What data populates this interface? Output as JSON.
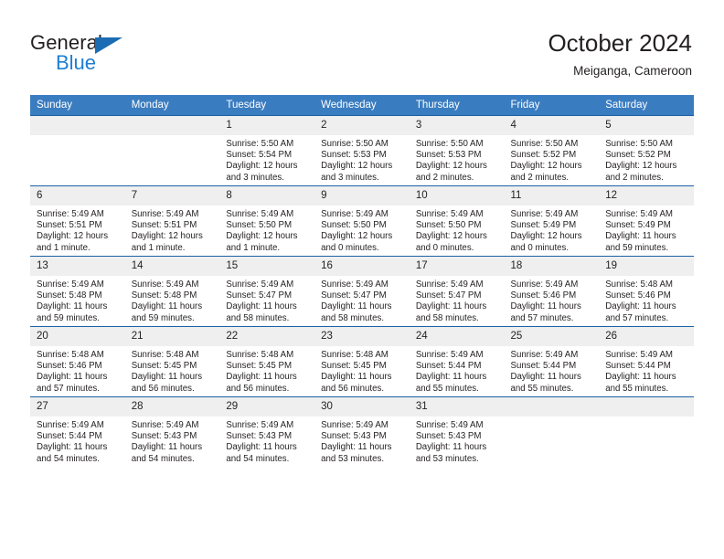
{
  "brand": {
    "name_top": "General",
    "name_bottom": "Blue",
    "triangle_color": "#1c6cb3",
    "blue_text_color": "#1b7fd4"
  },
  "header": {
    "title": "October 2024",
    "subtitle": "Meiganga, Cameroon",
    "header_bg": "#3a7cc0",
    "cell_border": "#1c60a8",
    "daynum_bg": "#efefef"
  },
  "weekday_headers": [
    "Sunday",
    "Monday",
    "Tuesday",
    "Wednesday",
    "Thursday",
    "Friday",
    "Saturday"
  ],
  "labels": {
    "sunrise_prefix": "Sunrise:",
    "sunset_prefix": "Sunset:",
    "daylight_prefix": "Daylight:"
  },
  "weeks": [
    [
      {
        "day": "",
        "blank": true
      },
      {
        "day": "",
        "blank": true
      },
      {
        "day": "1",
        "sunrise": "Sunrise: 5:50 AM",
        "sunset": "Sunset: 5:54 PM",
        "daylight_line1": "Daylight: 12 hours",
        "daylight_line2": "and 3 minutes."
      },
      {
        "day": "2",
        "sunrise": "Sunrise: 5:50 AM",
        "sunset": "Sunset: 5:53 PM",
        "daylight_line1": "Daylight: 12 hours",
        "daylight_line2": "and 3 minutes."
      },
      {
        "day": "3",
        "sunrise": "Sunrise: 5:50 AM",
        "sunset": "Sunset: 5:53 PM",
        "daylight_line1": "Daylight: 12 hours",
        "daylight_line2": "and 2 minutes."
      },
      {
        "day": "4",
        "sunrise": "Sunrise: 5:50 AM",
        "sunset": "Sunset: 5:52 PM",
        "daylight_line1": "Daylight: 12 hours",
        "daylight_line2": "and 2 minutes."
      },
      {
        "day": "5",
        "sunrise": "Sunrise: 5:50 AM",
        "sunset": "Sunset: 5:52 PM",
        "daylight_line1": "Daylight: 12 hours",
        "daylight_line2": "and 2 minutes."
      }
    ],
    [
      {
        "day": "6",
        "sunrise": "Sunrise: 5:49 AM",
        "sunset": "Sunset: 5:51 PM",
        "daylight_line1": "Daylight: 12 hours",
        "daylight_line2": "and 1 minute."
      },
      {
        "day": "7",
        "sunrise": "Sunrise: 5:49 AM",
        "sunset": "Sunset: 5:51 PM",
        "daylight_line1": "Daylight: 12 hours",
        "daylight_line2": "and 1 minute."
      },
      {
        "day": "8",
        "sunrise": "Sunrise: 5:49 AM",
        "sunset": "Sunset: 5:50 PM",
        "daylight_line1": "Daylight: 12 hours",
        "daylight_line2": "and 1 minute."
      },
      {
        "day": "9",
        "sunrise": "Sunrise: 5:49 AM",
        "sunset": "Sunset: 5:50 PM",
        "daylight_line1": "Daylight: 12 hours",
        "daylight_line2": "and 0 minutes."
      },
      {
        "day": "10",
        "sunrise": "Sunrise: 5:49 AM",
        "sunset": "Sunset: 5:50 PM",
        "daylight_line1": "Daylight: 12 hours",
        "daylight_line2": "and 0 minutes."
      },
      {
        "day": "11",
        "sunrise": "Sunrise: 5:49 AM",
        "sunset": "Sunset: 5:49 PM",
        "daylight_line1": "Daylight: 12 hours",
        "daylight_line2": "and 0 minutes."
      },
      {
        "day": "12",
        "sunrise": "Sunrise: 5:49 AM",
        "sunset": "Sunset: 5:49 PM",
        "daylight_line1": "Daylight: 11 hours",
        "daylight_line2": "and 59 minutes."
      }
    ],
    [
      {
        "day": "13",
        "sunrise": "Sunrise: 5:49 AM",
        "sunset": "Sunset: 5:48 PM",
        "daylight_line1": "Daylight: 11 hours",
        "daylight_line2": "and 59 minutes."
      },
      {
        "day": "14",
        "sunrise": "Sunrise: 5:49 AM",
        "sunset": "Sunset: 5:48 PM",
        "daylight_line1": "Daylight: 11 hours",
        "daylight_line2": "and 59 minutes."
      },
      {
        "day": "15",
        "sunrise": "Sunrise: 5:49 AM",
        "sunset": "Sunset: 5:47 PM",
        "daylight_line1": "Daylight: 11 hours",
        "daylight_line2": "and 58 minutes."
      },
      {
        "day": "16",
        "sunrise": "Sunrise: 5:49 AM",
        "sunset": "Sunset: 5:47 PM",
        "daylight_line1": "Daylight: 11 hours",
        "daylight_line2": "and 58 minutes."
      },
      {
        "day": "17",
        "sunrise": "Sunrise: 5:49 AM",
        "sunset": "Sunset: 5:47 PM",
        "daylight_line1": "Daylight: 11 hours",
        "daylight_line2": "and 58 minutes."
      },
      {
        "day": "18",
        "sunrise": "Sunrise: 5:49 AM",
        "sunset": "Sunset: 5:46 PM",
        "daylight_line1": "Daylight: 11 hours",
        "daylight_line2": "and 57 minutes."
      },
      {
        "day": "19",
        "sunrise": "Sunrise: 5:48 AM",
        "sunset": "Sunset: 5:46 PM",
        "daylight_line1": "Daylight: 11 hours",
        "daylight_line2": "and 57 minutes."
      }
    ],
    [
      {
        "day": "20",
        "sunrise": "Sunrise: 5:48 AM",
        "sunset": "Sunset: 5:46 PM",
        "daylight_line1": "Daylight: 11 hours",
        "daylight_line2": "and 57 minutes."
      },
      {
        "day": "21",
        "sunrise": "Sunrise: 5:48 AM",
        "sunset": "Sunset: 5:45 PM",
        "daylight_line1": "Daylight: 11 hours",
        "daylight_line2": "and 56 minutes."
      },
      {
        "day": "22",
        "sunrise": "Sunrise: 5:48 AM",
        "sunset": "Sunset: 5:45 PM",
        "daylight_line1": "Daylight: 11 hours",
        "daylight_line2": "and 56 minutes."
      },
      {
        "day": "23",
        "sunrise": "Sunrise: 5:48 AM",
        "sunset": "Sunset: 5:45 PM",
        "daylight_line1": "Daylight: 11 hours",
        "daylight_line2": "and 56 minutes."
      },
      {
        "day": "24",
        "sunrise": "Sunrise: 5:49 AM",
        "sunset": "Sunset: 5:44 PM",
        "daylight_line1": "Daylight: 11 hours",
        "daylight_line2": "and 55 minutes."
      },
      {
        "day": "25",
        "sunrise": "Sunrise: 5:49 AM",
        "sunset": "Sunset: 5:44 PM",
        "daylight_line1": "Daylight: 11 hours",
        "daylight_line2": "and 55 minutes."
      },
      {
        "day": "26",
        "sunrise": "Sunrise: 5:49 AM",
        "sunset": "Sunset: 5:44 PM",
        "daylight_line1": "Daylight: 11 hours",
        "daylight_line2": "and 55 minutes."
      }
    ],
    [
      {
        "day": "27",
        "sunrise": "Sunrise: 5:49 AM",
        "sunset": "Sunset: 5:44 PM",
        "daylight_line1": "Daylight: 11 hours",
        "daylight_line2": "and 54 minutes."
      },
      {
        "day": "28",
        "sunrise": "Sunrise: 5:49 AM",
        "sunset": "Sunset: 5:43 PM",
        "daylight_line1": "Daylight: 11 hours",
        "daylight_line2": "and 54 minutes."
      },
      {
        "day": "29",
        "sunrise": "Sunrise: 5:49 AM",
        "sunset": "Sunset: 5:43 PM",
        "daylight_line1": "Daylight: 11 hours",
        "daylight_line2": "and 54 minutes."
      },
      {
        "day": "30",
        "sunrise": "Sunrise: 5:49 AM",
        "sunset": "Sunset: 5:43 PM",
        "daylight_line1": "Daylight: 11 hours",
        "daylight_line2": "and 53 minutes."
      },
      {
        "day": "31",
        "sunrise": "Sunrise: 5:49 AM",
        "sunset": "Sunset: 5:43 PM",
        "daylight_line1": "Daylight: 11 hours",
        "daylight_line2": "and 53 minutes."
      },
      {
        "day": "",
        "blank": true
      },
      {
        "day": "",
        "blank": true
      }
    ]
  ]
}
